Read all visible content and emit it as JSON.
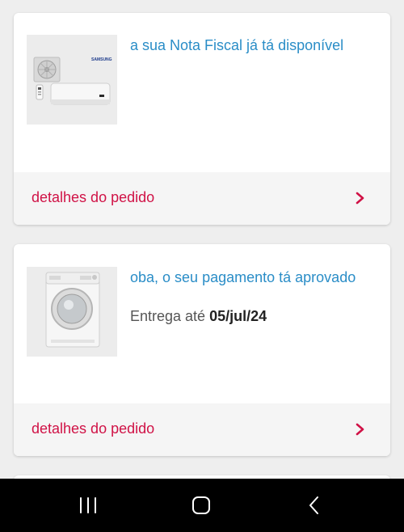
{
  "orders": [
    {
      "image_icon": "air-conditioner-image",
      "status": "a sua Nota Fiscal já tá disponível",
      "delivery_prefix": "",
      "delivery_date": "",
      "details_link": "detalhes do pedido",
      "brand_mark": "SAMSUNG"
    },
    {
      "image_icon": "washing-machine-image",
      "status": "oba, o seu pagamento tá aprovado",
      "delivery_prefix": "Entrega até ",
      "delivery_date": "05/jul/24",
      "details_link": "detalhes do pedido"
    }
  ],
  "colors": {
    "status": "#2a8dc7",
    "link": "#d01246",
    "background": "#eeeeee",
    "footer": "#f5f5f5"
  },
  "navbar": {
    "recents_icon": "recents-icon",
    "home_icon": "home-icon",
    "back_icon": "back-icon"
  }
}
